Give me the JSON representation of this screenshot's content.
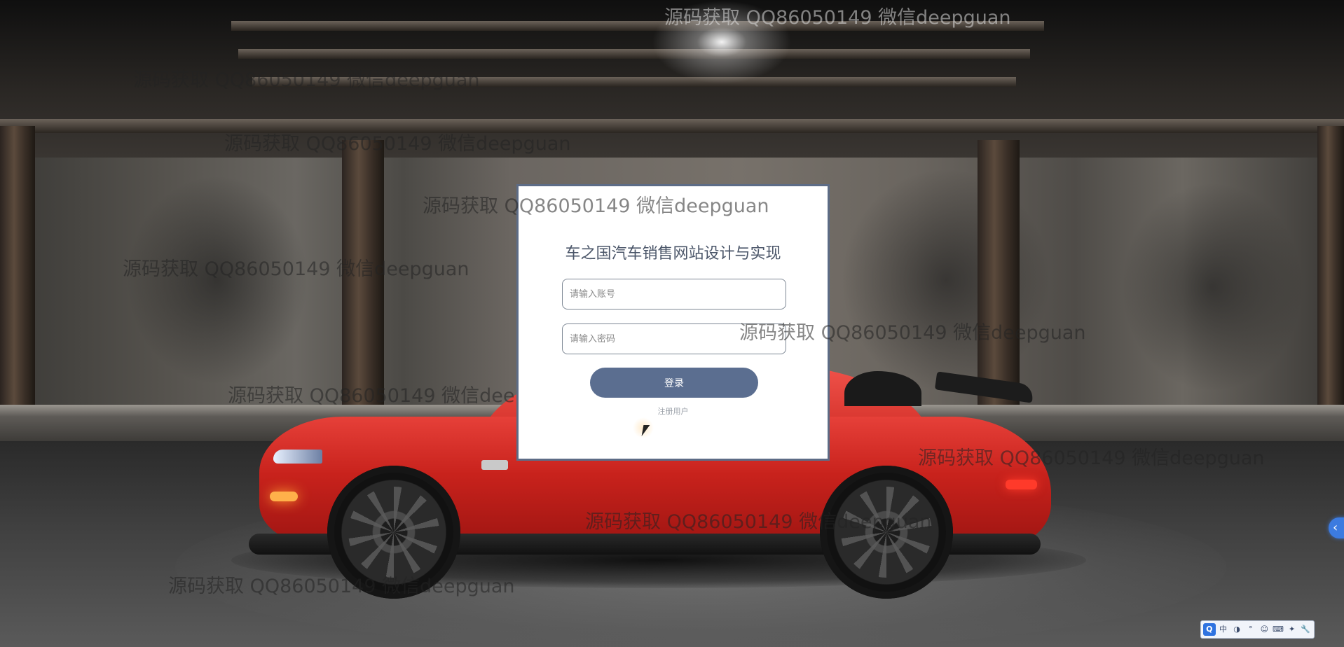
{
  "login": {
    "title": "车之国汽车销售网站设计与实现",
    "username_placeholder": "请输入账号",
    "password_placeholder": "请输入密码",
    "login_button": "登录",
    "register_link": "注册用户"
  },
  "watermark": {
    "text": "源码获取 QQ86050149 微信deepguan"
  },
  "side_tab": {
    "icon": "chevron-left-icon",
    "glyph": "‹"
  },
  "ime_toolbar": {
    "items": [
      "Q",
      "中",
      "◑",
      "°",
      "☺",
      "⌨",
      "✦",
      "🔧"
    ]
  },
  "colors": {
    "dialog_border": "#5d6c86",
    "button_bg": "#5b6e90",
    "car_red": "#d32a23",
    "side_tab": "#3c7be0"
  }
}
